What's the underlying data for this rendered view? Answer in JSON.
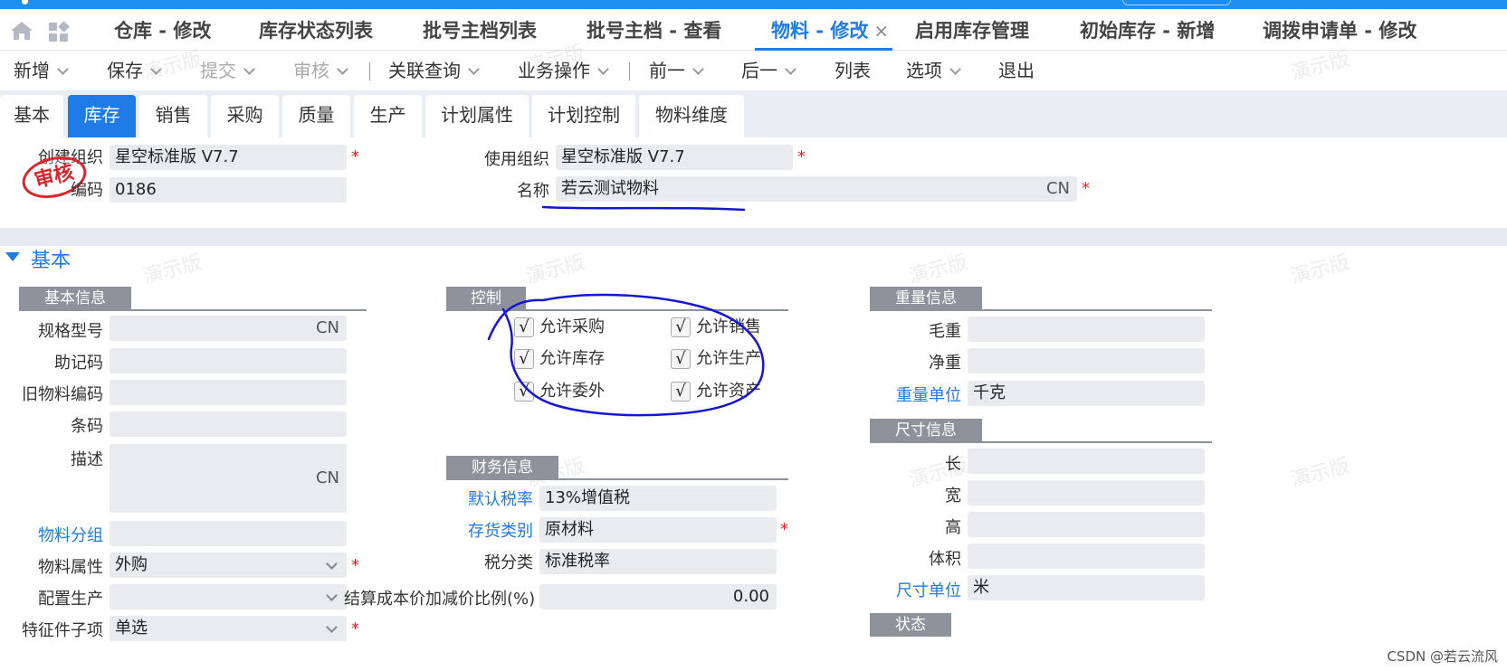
{
  "tabs": [
    {
      "label": "仓库 - 修改",
      "active": false
    },
    {
      "label": "库存状态列表",
      "active": false
    },
    {
      "label": "批号主档列表",
      "active": false
    },
    {
      "label": "批号主档 - 查看",
      "active": false
    },
    {
      "label": "物料 - 修改",
      "active": true,
      "close": "×"
    },
    {
      "label": "启用库存管理",
      "active": false
    },
    {
      "label": "初始库存 - 新增",
      "active": false
    },
    {
      "label": "调拨申请单 - 修改",
      "active": false
    }
  ],
  "toolbar": {
    "new": "新增",
    "save": "保存",
    "submit": "提交",
    "audit": "审核",
    "related": "关联查询",
    "business": "业务操作",
    "prev": "前一",
    "next": "后一",
    "list": "列表",
    "options": "选项",
    "exit": "退出"
  },
  "subtabs": [
    "基本",
    "库存",
    "销售",
    "采购",
    "质量",
    "生产",
    "计划属性",
    "计划控制",
    "物料维度"
  ],
  "active_subtab": "库存",
  "header": {
    "stamp": "审核",
    "create_org_label": "创建组织",
    "create_org_value": "星空标准版 V7.7",
    "code_label": "编码",
    "code_value": "0186",
    "use_org_label": "使用组织",
    "use_org_value": "星空标准版 V7.7",
    "name_label": "名称",
    "name_value": "若云测试物料",
    "name_lang": "CN",
    "required": "*"
  },
  "section": {
    "title": "基本"
  },
  "basic_info": {
    "title": "基本信息",
    "spec_label": "规格型号",
    "spec_lang": "CN",
    "mnemonic_label": "助记码",
    "old_code_label": "旧物料编码",
    "barcode_label": "条码",
    "desc_label": "描述",
    "desc_lang": "CN",
    "group_label": "物料分组",
    "attr_label": "物料属性",
    "attr_value": "外购",
    "config_label": "配置生产",
    "feature_label": "特征件子项",
    "feature_value": "单选"
  },
  "control": {
    "title": "控制",
    "checked_glyph": "√",
    "items": [
      {
        "label": "允许采购",
        "checked": true
      },
      {
        "label": "允许销售",
        "checked": true
      },
      {
        "label": "允许库存",
        "checked": true
      },
      {
        "label": "允许生产",
        "checked": true
      },
      {
        "label": "允许委外",
        "checked": true
      },
      {
        "label": "允许资产",
        "checked": true
      }
    ]
  },
  "finance": {
    "title": "财务信息",
    "tax_rate_label": "默认税率",
    "tax_rate_value": "13%增值税",
    "inv_cat_label": "存货类别",
    "inv_cat_value": "原材料",
    "tax_class_label": "税分类",
    "tax_class_value": "标准税率",
    "cost_ratio_label": "结算成本价加减价比例(%)",
    "cost_ratio_value": "0.00"
  },
  "weight": {
    "title": "重量信息",
    "gross_label": "毛重",
    "net_label": "净重",
    "unit_label": "重量单位",
    "unit_value": "千克"
  },
  "size": {
    "title": "尺寸信息",
    "length_label": "长",
    "width_label": "宽",
    "height_label": "高",
    "volume_label": "体积",
    "unit_label": "尺寸单位",
    "unit_value": "米"
  },
  "status": {
    "title": "状态"
  },
  "watermark": "演示版",
  "credit": "CSDN @若云流风",
  "colors": {
    "accent": "#1e7be8",
    "required": "#e22222",
    "annotation": "#1515d6",
    "stamp": "#d9252b"
  }
}
